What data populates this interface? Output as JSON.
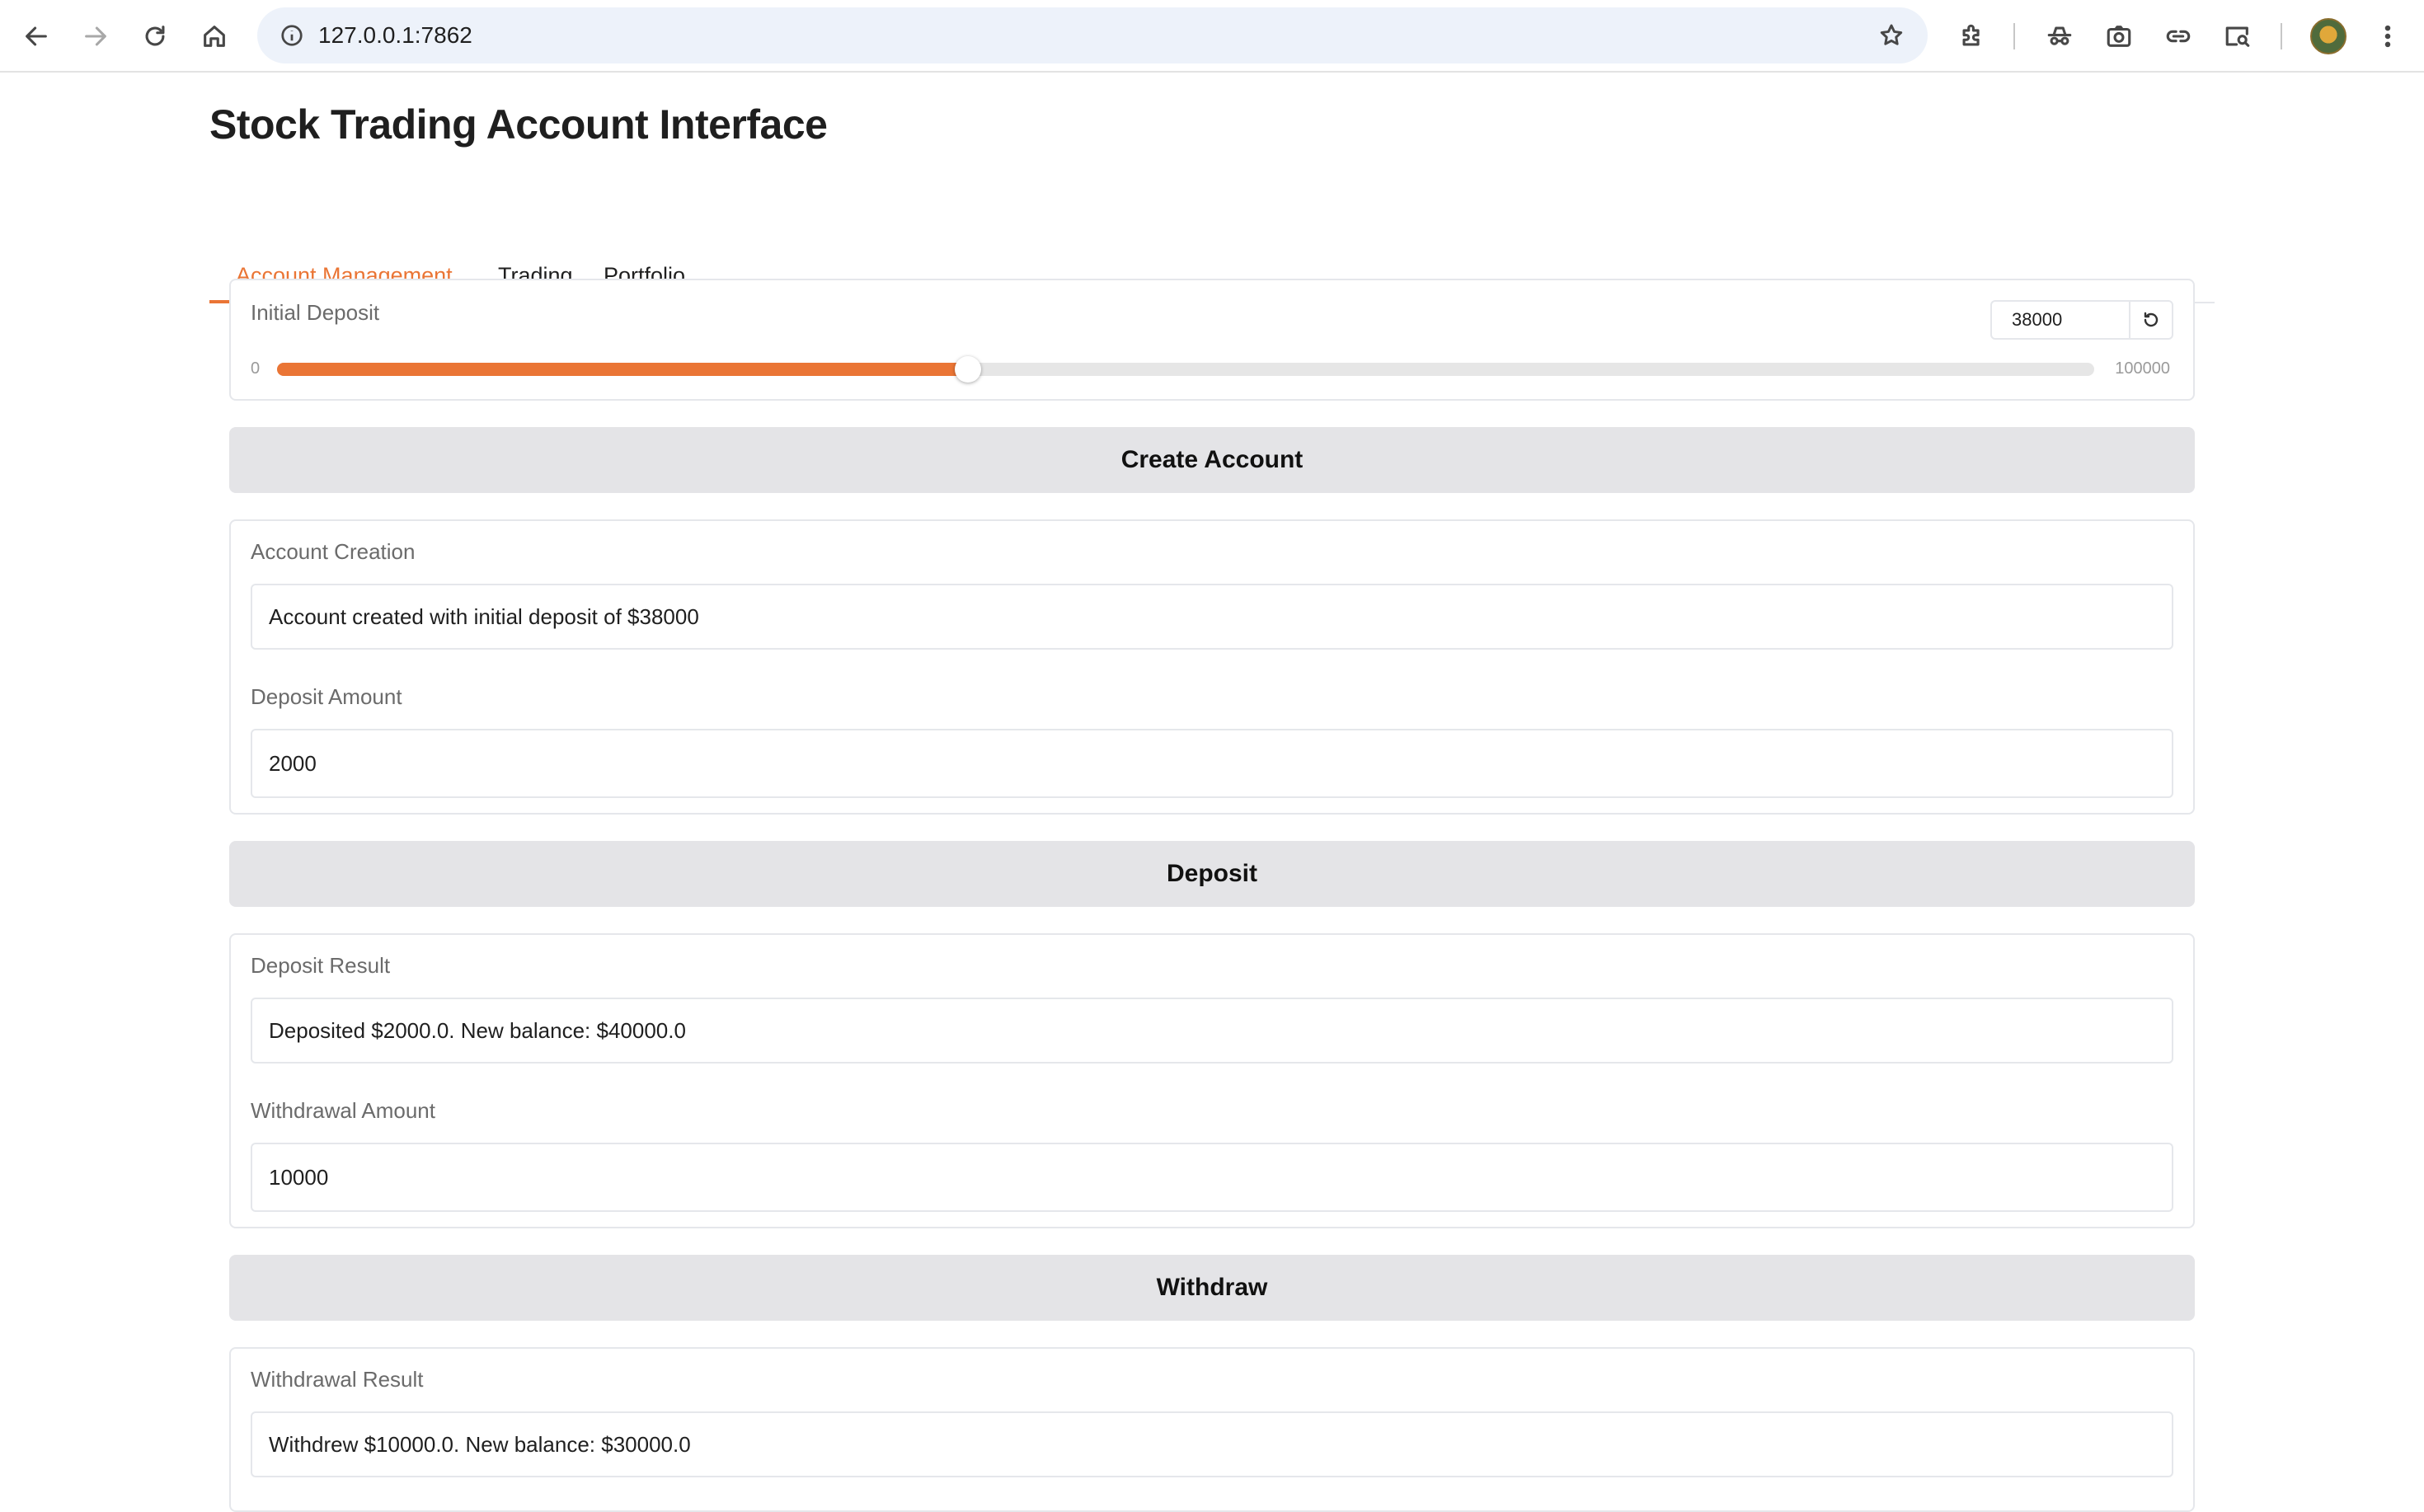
{
  "browser": {
    "url": "127.0.0.1:7862",
    "icons": [
      "back-icon",
      "forward-icon",
      "reload-icon",
      "home-icon",
      "site-info-icon",
      "bookmark-star-icon",
      "extensions-icon",
      "incognito-icon",
      "screenshot-icon",
      "link-icon",
      "tab-search-icon",
      "profile-avatar",
      "menu-icon"
    ]
  },
  "app": {
    "title": "Stock Trading Account Interface",
    "accent_color": "#ea7535",
    "tabs": [
      {
        "label": "Account Management",
        "active": true
      },
      {
        "label": "Trading",
        "active": false
      },
      {
        "label": "Portfolio",
        "active": false
      }
    ]
  },
  "account": {
    "initial_deposit": {
      "label": "Initial Deposit",
      "value": "38000",
      "min": "0",
      "max": "100000",
      "fraction": 0.38
    },
    "create_button": "Create Account",
    "creation": {
      "label": "Account Creation",
      "value": "Account created with initial deposit of $38000"
    },
    "deposit_amount": {
      "label": "Deposit Amount",
      "value": "2000"
    },
    "deposit_button": "Deposit",
    "deposit_result": {
      "label": "Deposit Result",
      "value": "Deposited $2000.0. New balance: $40000.0"
    },
    "withdrawal_amount": {
      "label": "Withdrawal Amount",
      "value": "10000"
    },
    "withdraw_button": "Withdraw",
    "withdrawal_result": {
      "label": "Withdrawal Result",
      "value": "Withdrew $10000.0. New balance: $30000.0"
    }
  }
}
